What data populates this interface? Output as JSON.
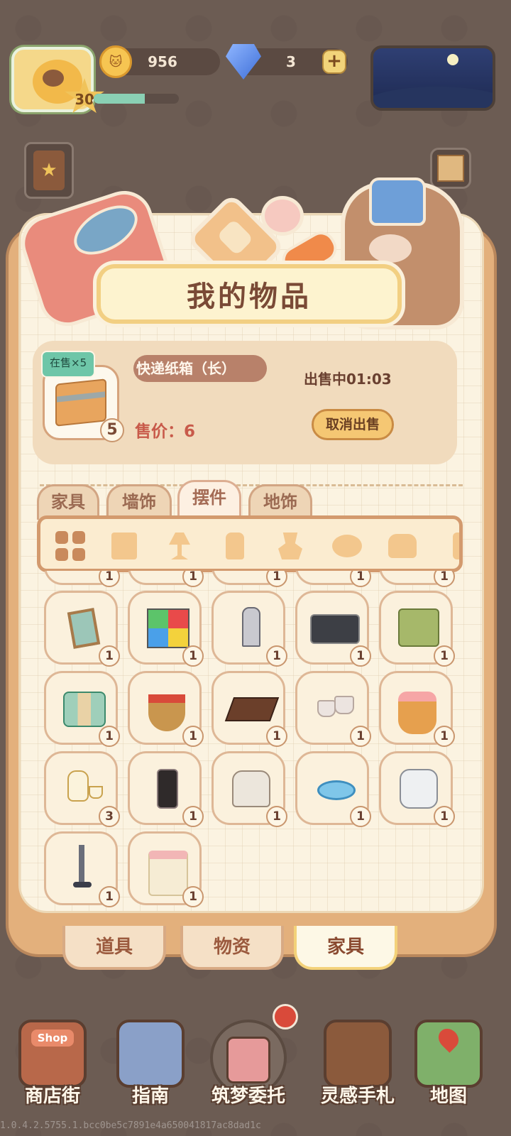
{
  "hud": {
    "level": "30",
    "coins": "956",
    "gems": "3",
    "plus_label": "+",
    "xp_progress": 0.6
  },
  "panel": {
    "title": "我的物品"
  },
  "sale": {
    "tag": "在售×5",
    "item_name": "快递纸箱（长）",
    "status": "出售中01:03",
    "price": "售价：6",
    "count": "5",
    "cancel_label": "取消出售"
  },
  "categories": [
    "家具",
    "墙饰",
    "摆件",
    "地饰"
  ],
  "active_category": "摆件",
  "subcategories": [
    "all-grid-icon",
    "scroll-icon",
    "lamp-icon",
    "bottle-icon",
    "planter-icon",
    "cow-skull-icon",
    "kettle-icon",
    "cactus-icon"
  ],
  "items": [
    {
      "name": "picture-frame",
      "qty": "1"
    },
    {
      "name": "rubiks-cube",
      "qty": "1"
    },
    {
      "name": "chess-piece-statue",
      "qty": "1"
    },
    {
      "name": "boombox",
      "qty": "1"
    },
    {
      "name": "green-oven",
      "qty": "1"
    },
    {
      "name": "storage-jars",
      "qty": "1"
    },
    {
      "name": "apple-basket",
      "qty": "1"
    },
    {
      "name": "chocolate-cake-board",
      "qty": "1"
    },
    {
      "name": "cooking-pots",
      "qty": "1"
    },
    {
      "name": "flower-basket",
      "qty": "1"
    },
    {
      "name": "tea-set",
      "qty": "3"
    },
    {
      "name": "coffee-grinder",
      "qty": "1"
    },
    {
      "name": "stand-mixer",
      "qty": "1"
    },
    {
      "name": "pet-bowl",
      "qty": "1"
    },
    {
      "name": "air-purifier",
      "qty": "1"
    },
    {
      "name": "cordless-vacuum",
      "qty": "1"
    },
    {
      "name": "gift-bag",
      "qty": "1"
    }
  ],
  "partial_row_qty": [
    "1",
    "1",
    "1",
    "1",
    "1"
  ],
  "bottom_tabs": [
    "道具",
    "物资",
    "家具"
  ],
  "active_bottom_tab": "家具",
  "nav": [
    {
      "label": "商店街",
      "icon": "shop-icon",
      "sign": "Shop"
    },
    {
      "label": "指南",
      "icon": "guide-icon"
    },
    {
      "label": "筑梦委托",
      "icon": "commission-icon"
    },
    {
      "label": "灵感手札",
      "icon": "notebook-icon"
    },
    {
      "label": "地图",
      "icon": "map-icon"
    }
  ],
  "version": "1.0.4.2.5755.1.bcc0be5c7891e4a650041817ac8dad1c",
  "colors": {
    "background": "#6c5c53",
    "panel": "#fbf3e1",
    "accent_gold": "#f5c773",
    "price_red": "#c85a4a",
    "tag_green": "#6ec6a8"
  }
}
